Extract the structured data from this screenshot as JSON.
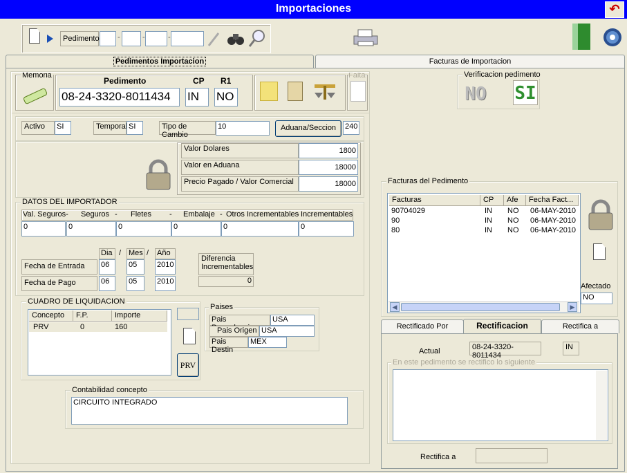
{
  "window": {
    "title": "Importaciones"
  },
  "toolbar": {
    "pedimento_label": "Pedimento"
  },
  "tabs": [
    {
      "label": "Pedimentos Importacion"
    },
    {
      "label": "Facturas de Importacion"
    }
  ],
  "left": {
    "memoria_label": "Memoria",
    "pedimento_header": "Pedimento",
    "cp_header": "CP",
    "r1_header": "R1",
    "pedimento_value": "08-24-3320-8011434",
    "cp_value": "IN",
    "r1_value": "NO",
    "falta_label": "Falta",
    "activo_label": "Activo",
    "activo_value": "SI",
    "temporal_label": "Temporal",
    "temporal_value": "SI",
    "tipo_cambio_label": "Tipo de Cambio",
    "tipo_cambio_value": "10",
    "aduana_button": "Aduana/Seccion",
    "aduana_value": "240",
    "valor_dolares_label": "Valor Dolares",
    "valor_dolares_value": "1800",
    "valor_aduana_label": "Valor en Aduana",
    "valor_aduana_value": "18000",
    "precio_pagado_label": "Precio Pagado   / Valor Comercial",
    "precio_pagado_value": "18000",
    "importador": {
      "title": "DATOS DEL IMPORTADOR",
      "headers": [
        "Val. Seguros-",
        "Seguros",
        "-",
        "Fletes",
        "-",
        "Embalaje",
        "-",
        "Otros Incrementables",
        "-",
        "Incrementables"
      ],
      "values": [
        "0",
        "0",
        "0",
        "0",
        "0",
        "0"
      ],
      "dia": "Dia",
      "mes": "Mes",
      "anio": "Año",
      "slash1": "/",
      "slash2": "/",
      "fecha_entrada_label": "Fecha de Entrada",
      "fecha_entrada": [
        "06",
        "05",
        "2010"
      ],
      "fecha_pago_label": "Fecha de Pago",
      "fecha_pago": [
        "06",
        "05",
        "2010"
      ],
      "diferencia_label": "Diferencia Incrementables",
      "diferencia_value": "0"
    },
    "liquidacion": {
      "title": "CUADRO DE LIQUIDACION",
      "headers": [
        "Concepto",
        "F.P.",
        "Importe"
      ],
      "rows": [
        [
          "PRV",
          "0",
          "160"
        ]
      ],
      "prv_button": "PRV"
    },
    "paises": {
      "title": "Paises",
      "procedencia_label": "Pais Procedencia",
      "procedencia_value": "USA",
      "origen_label": "Pais Origen",
      "origen_value": "USA",
      "destino_label": "Pais Destin",
      "destino_value": "MEX"
    },
    "contabilidad": {
      "title": "Contabilidad concepto",
      "value": "CIRCUITO INTEGRADO"
    }
  },
  "right": {
    "verificacion_title": "Verificacion pedimento",
    "no_label": "NO",
    "si_label": "SI",
    "facturas_title": "Facturas del Pedimento",
    "facturas_headers": [
      "Facturas",
      "CP",
      "Afe",
      "Fecha Fact..."
    ],
    "facturas_rows": [
      [
        "90704029",
        "IN",
        "NO",
        "06-MAY-2010"
      ],
      [
        "90",
        "IN",
        "NO",
        "06-MAY-2010"
      ],
      [
        "80",
        "IN",
        "NO",
        "06-MAY-2010"
      ]
    ],
    "afectado_label": "Afectado",
    "afectado_value": "NO",
    "tabs": [
      {
        "label": "Rectificado Por"
      },
      {
        "label": "Rectificacion"
      },
      {
        "label": "Rectifica a"
      }
    ],
    "actual_label": "Actual",
    "actual_value": "08-24-3320-8011434",
    "actual_cp": "IN",
    "rectifico_label": "En este pedimento se rectifico lo siguiente",
    "rectifica_a_label": "Rectifica a"
  },
  "colors": {
    "titlebar": "#0000ff",
    "window_bg": "#ece9d8"
  }
}
